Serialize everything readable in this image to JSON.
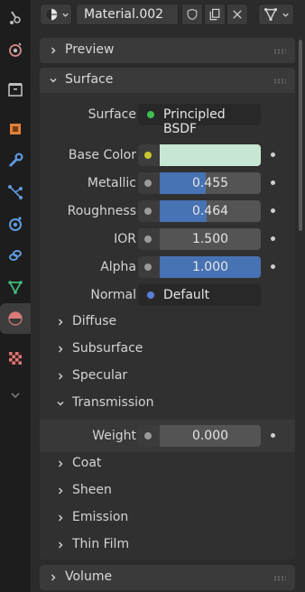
{
  "header": {
    "material_name": "Material.002"
  },
  "tabs": [
    {
      "name": "tool-icon"
    },
    {
      "name": "render-icon"
    },
    {
      "name": "output-icon"
    },
    {
      "name": "object-icon"
    },
    {
      "name": "modifier-icon"
    },
    {
      "name": "particles-icon"
    },
    {
      "name": "physics-icon"
    },
    {
      "name": "constraints-icon"
    },
    {
      "name": "data-icon"
    },
    {
      "name": "material-icon",
      "active": true
    },
    {
      "name": "texture-icon"
    },
    {
      "name": "more-icon"
    }
  ],
  "panels": {
    "preview": "Preview",
    "surface": "Surface",
    "volume": "Volume"
  },
  "surface": {
    "surface_label": "Surface",
    "shader": "Principled BSDF",
    "base_color_label": "Base Color",
    "base_color_hex": "#c8e6d4",
    "metallic_label": "Metallic",
    "metallic_value": "0.455",
    "metallic_fraction": 0.455,
    "roughness_label": "Roughness",
    "roughness_value": "0.464",
    "roughness_fraction": 0.464,
    "ior_label": "IOR",
    "ior_value": "1.500",
    "alpha_label": "Alpha",
    "alpha_value": "1.000",
    "alpha_fraction": 1.0,
    "normal_label": "Normal",
    "normal_value": "Default",
    "accent_color": "#4772b3"
  },
  "subpanels": {
    "diffuse": "Diffuse",
    "subsurface": "Subsurface",
    "specular": "Specular",
    "transmission": "Transmission",
    "coat": "Coat",
    "sheen": "Sheen",
    "emission": "Emission",
    "thin_film": "Thin Film"
  },
  "transmission": {
    "weight_label": "Weight",
    "weight_value": "0.000"
  }
}
